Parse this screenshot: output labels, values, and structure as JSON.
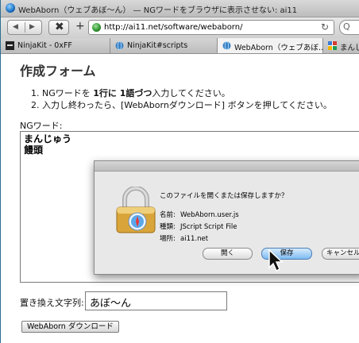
{
  "window": {
    "title": "WebAborn（ウェブあぼ〜ん） — NGワードをブラウザに表示させない: ai11"
  },
  "navbar": {
    "back_icon": "back-arrow-icon",
    "forward_icon": "forward-arrow-icon",
    "url": "http://ai11.net/software/webaborn/",
    "search_glyph": "Q"
  },
  "tabs": [
    {
      "label": "NinjaKit - 0xFF",
      "icon": "ninja-icon"
    },
    {
      "label": "NinjaKit#scripts",
      "icon": "globe-icon"
    },
    {
      "label": "WebAborn（ウェブあぼ…",
      "icon": "globe-icon"
    },
    {
      "label": "まんじ",
      "icon": "google-icon"
    }
  ],
  "page": {
    "heading": "作成フォーム",
    "step1_prefix": "1.  NGワードを ",
    "step1_bold": "1行に 1語づつ",
    "step1_suffix": "入力してください。",
    "step2": "2.  入力し終わったら、[WebAbornダウンロード] ボタンを押してください。",
    "ng_label": "NGワード:",
    "ng_words": [
      "まんじゅう",
      "饅頭"
    ],
    "replace_label": "置き換え文字列:",
    "replace_value": "あぼ〜ん",
    "download_button": "WebAborn ダウンロード"
  },
  "dialog": {
    "question": "このファイルを開くまたは保存しますか？",
    "name_label": "名前:",
    "name_value": "WebAborn.user.js",
    "type_label": "種類:",
    "type_value": "JScript Script File",
    "location_label": "場所:",
    "location_value": "ai11.net",
    "open_button": "開く",
    "save_button": "保存",
    "cancel_button": "キャンセル"
  },
  "colors": {
    "accent": "#3a7ea3",
    "save_button": "#7fbaf1"
  }
}
